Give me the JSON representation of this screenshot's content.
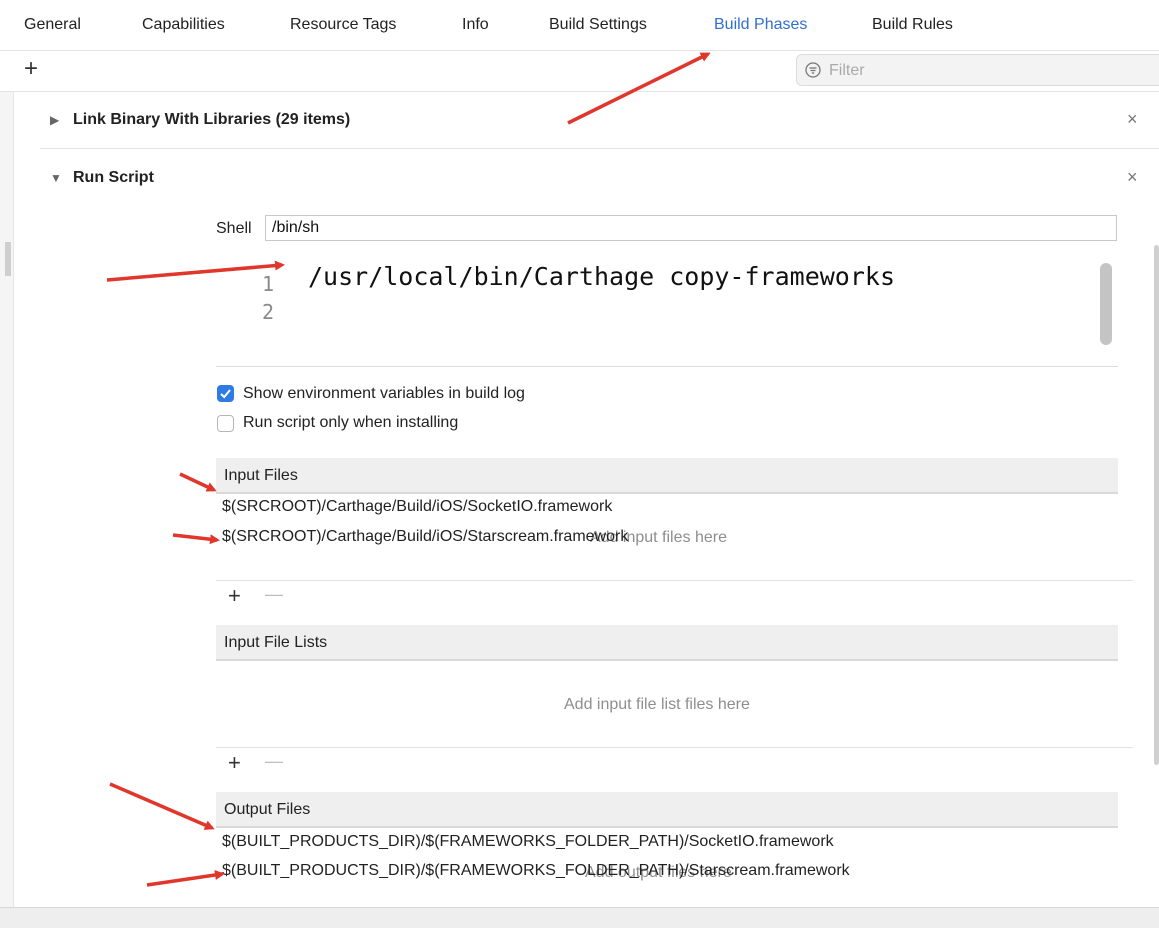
{
  "tabs": [
    "General",
    "Capabilities",
    "Resource Tags",
    "Info",
    "Build Settings",
    "Build Phases",
    "Build Rules"
  ],
  "active_tab": "Build Phases",
  "toolbar": {
    "add_glyph": "+",
    "filter_placeholder": "Filter"
  },
  "phases": {
    "link": {
      "title": "Link Binary With Libraries (29 items)",
      "collapsed_glyph": "▶",
      "close_glyph": "×"
    },
    "run_script": {
      "title": "Run Script",
      "expanded_glyph": "▼",
      "close_glyph": "×",
      "shell_label": "Shell",
      "shell_value": "/bin/sh",
      "code_lines": [
        {
          "num": "1",
          "text": "/usr/local/bin/Carthage copy-frameworks"
        },
        {
          "num": "2",
          "text": ""
        }
      ],
      "checkbox_show_env": {
        "label": "Show environment variables in build log",
        "checked": true
      },
      "checkbox_install_only": {
        "label": "Run script only when installing",
        "checked": false
      },
      "input_files": {
        "header": "Input Files",
        "items": [
          "$(SRCROOT)/Carthage/Build/iOS/SocketIO.framework",
          "$(SRCROOT)/Carthage/Build/iOS/Starscream.framework"
        ],
        "placeholder": "Add input files here"
      },
      "input_file_lists": {
        "header": "Input File Lists",
        "placeholder": "Add input file list files here"
      },
      "output_files": {
        "header": "Output Files",
        "items": [
          "$(BUILT_PRODUCTS_DIR)/$(FRAMEWORKS_FOLDER_PATH)/SocketIO.framework",
          "$(BUILT_PRODUCTS_DIR)/$(FRAMEWORKS_FOLDER_PATH)/Starscream.framework"
        ],
        "placeholder": "Add output files here"
      },
      "add_glyph": "+",
      "remove_glyph": "—"
    }
  },
  "annotation_color": "#e0362c",
  "accent_color": "#2f6fce"
}
